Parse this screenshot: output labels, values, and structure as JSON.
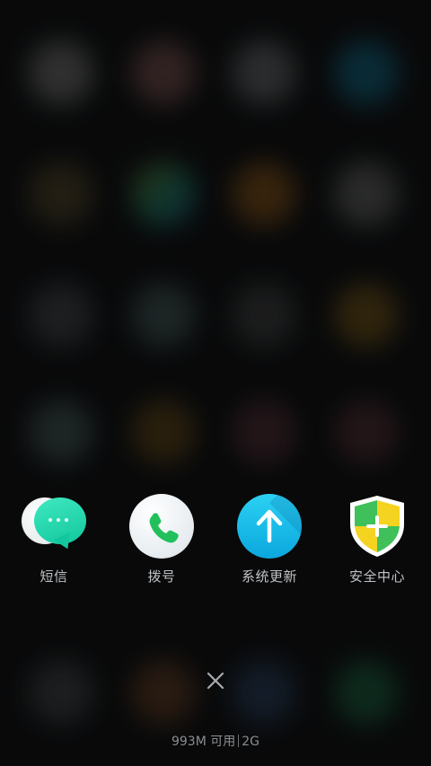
{
  "recent_apps": [
    {
      "label": "短信",
      "icon": "sms-icon"
    },
    {
      "label": "拨号",
      "icon": "phone-icon"
    },
    {
      "label": "系统更新",
      "icon": "system-update-icon"
    },
    {
      "label": "安全中心",
      "icon": "security-center-icon"
    }
  ],
  "close": {
    "icon": "close-icon"
  },
  "memory": {
    "available": "993M 可用",
    "total": "2G"
  },
  "colors": {
    "sms": "#1fd6a8",
    "update": "#17b9e8",
    "shield_yellow": "#f5d321",
    "shield_green": "#3fc05a",
    "label": "#bfc2c6"
  }
}
